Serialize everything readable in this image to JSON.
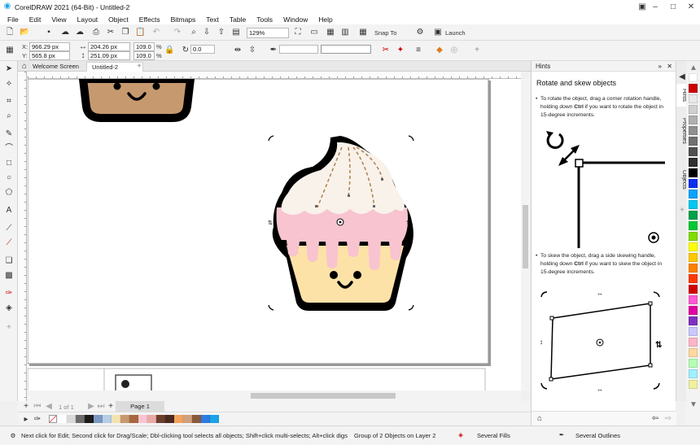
{
  "window": {
    "title": "CorelDRAW 2021 (64-Bit) - Untitled-2"
  },
  "menu": [
    "File",
    "Edit",
    "View",
    "Layout",
    "Object",
    "Effects",
    "Bitmaps",
    "Text",
    "Table",
    "Tools",
    "Window",
    "Help"
  ],
  "toolbar": {
    "zoom": "129%",
    "snap_to": "Snap To",
    "launch": "Launch"
  },
  "propbar": {
    "x": "966.29 px",
    "y": "565.8 px",
    "x_label": "X:",
    "y_label": "Y:",
    "width": "204.26 px",
    "height": "251.09 px",
    "scale_w": "109.0",
    "scale_h": "109.0",
    "pct": "%",
    "rotation": "0.0"
  },
  "tabs": {
    "welcome": "Welcome Screen",
    "doc": "Untitled-2"
  },
  "page_nav": {
    "counter": "1  of  1",
    "page_tab": "Page 1"
  },
  "hints": {
    "header": "Hints",
    "title": "Rotate and skew objects",
    "para1_pre": "To rotate the object, drag a corner rotation handle, holding down ",
    "para1_key": "Ctrl",
    "para1_post": " if you want to rotate the object in 15-degree increments.",
    "para2_pre": "To skew the object, drag a side skewing handle, holding down ",
    "para2_key": "Ctrl",
    "para2_post": " if you want to skew the object in 15-degree increments."
  },
  "side_tabs": [
    "Hints",
    "Properties",
    "Objects"
  ],
  "status": {
    "hint": "Next click for Edit; Second click for Drag/Scale; Dbl-clicking tool selects all objects; Shift+click multi-selects; Alt+click digs",
    "selection": "Group of 2 Objects on Layer 2",
    "fill": "Several Fills",
    "outline": "Several Outlines"
  },
  "doc_palette": [
    "#ffffff",
    "#d9d9d9",
    "#6b6b6b",
    "#1a1a1a",
    "#7a99c0",
    "#b5cde6",
    "#f4e3b0",
    "#c69a6e",
    "#a7673f",
    "#f7c4cf",
    "#e9a9a5",
    "#6b3f2b",
    "#4b2a20",
    "#f3a35e",
    "#cfa07d",
    "#8a5a3c",
    "#2d7be0",
    "#1aa3e6"
  ],
  "color_palette": [
    "#ffffff",
    "#c90000",
    "#e8e8e8",
    "#d0d0d0",
    "#b0b0b0",
    "#909090",
    "#707070",
    "#505050",
    "#303030",
    "#000000",
    "#0b2ff0",
    "#0ba3ff",
    "#00c8f0",
    "#00a04a",
    "#00c832",
    "#7fdc00",
    "#ffff00",
    "#ffc800",
    "#ff8000",
    "#ff3a00",
    "#d00000",
    "#ff5ad2",
    "#e000a0",
    "#8030c0",
    "#c8c8ff",
    "#ffb4c8",
    "#ffd8a0",
    "#b4ffb4",
    "#a0f0ff",
    "#f0f0a0"
  ],
  "colors": {
    "accent": "#1aa3e6",
    "cupcake_outline": "#000000",
    "frosting": "#f8f2ea",
    "pink_drip": "#f7c4cf",
    "cake": "#fde2a8",
    "top_cupcake": "#c69a6e"
  }
}
